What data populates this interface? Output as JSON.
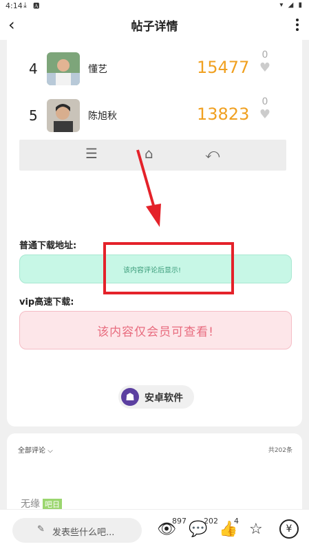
{
  "status_bar": {
    "time": "4:14",
    "left_icons": "⤓ 🅰",
    "right_icons": "▾ ◢ ▮"
  },
  "nav": {
    "back_icon": "‹",
    "title": "帖子详情"
  },
  "ranking": [
    {
      "rank": "4",
      "name": "懂艺",
      "score": "15477",
      "likes": "0"
    },
    {
      "rank": "5",
      "name": "陈旭秋",
      "score": "13823",
      "likes": "0"
    }
  ],
  "system_nav": {
    "menu": "☰",
    "home": "⌂",
    "back": "⤺"
  },
  "download": {
    "normal_label": "普通下载地址:",
    "normal_text": "该内容评论后显示!",
    "vip_label": "vip高速下载:",
    "vip_text": "该内容仅会员可查看!"
  },
  "tag": {
    "icon": "android-icon",
    "label": "安卓软件"
  },
  "comments": {
    "filter": "全部评论",
    "total": "共202条",
    "peek_name": "无缘",
    "peek_badge": "吧日"
  },
  "bottom": {
    "placeholder": "发表些什么吧...",
    "views": "897",
    "comments_count": "202",
    "likes_count": "4"
  },
  "colors": {
    "accent_score": "#f0a020",
    "highlight_box": "#e4222a",
    "arrow": "#e4222a"
  }
}
